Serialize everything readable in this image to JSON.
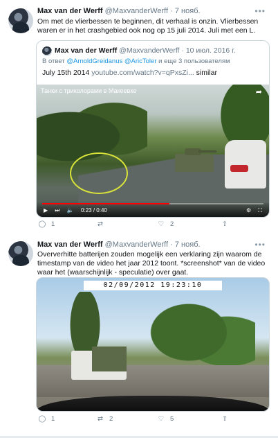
{
  "tweets": [
    {
      "name": "Max van der Werff",
      "handle": "@MaxvanderWerff",
      "date": "· 7 нояб.",
      "more": "•••",
      "text": "Om met de vlierbessen te beginnen, dit verhaal is onzin. Vlierbessen waren er in het crashgebied ook nog op 15 juli 2014. Juli met een L.",
      "quote": {
        "name": "Max van der Werff",
        "handle": "@MaxvanderWerff",
        "date": "· 10 июл. 2016 г.",
        "reply_prefix": "В ответ",
        "reply_user1": "@ArnoldGreidanus",
        "reply_user2": "@AricToler",
        "reply_suffix": " и еще 3 пользователям",
        "text": "July 15th 2014 ",
        "link": "youtube.com/watch?v=qPxsZi...",
        "text_suffix": " similar",
        "video": {
          "title": "Танки с триколорами в Макеевке",
          "time": "0:23 / 0:40",
          "progress": 0.575
        }
      },
      "actions": {
        "reply": "1",
        "retweet": "",
        "like": "2",
        "share": ""
      }
    },
    {
      "name": "Max van der Werff",
      "handle": "@MaxvanderWerff",
      "date": "· 7 нояб.",
      "more": "•••",
      "text": "Oververhitte batterijen zouden mogelijk een verklaring zijn waarom de timestamp van de video het jaar 2012 toont. *screenshot* van de video waar het (waarschijnlijk - speculatie) over gaat.",
      "photo_timestamp": "02/09/2012 19:23:10",
      "actions": {
        "reply": "1",
        "retweet": "2",
        "like": "5",
        "share": ""
      }
    }
  ],
  "icons": {
    "reply": "◯",
    "retweet": "⇄",
    "like": "♡",
    "share": "⇧",
    "play": "▶",
    "next": "⏭",
    "volume": "🔈",
    "settings": "⚙",
    "fullscreen": "⛶",
    "share_video": "➦"
  }
}
